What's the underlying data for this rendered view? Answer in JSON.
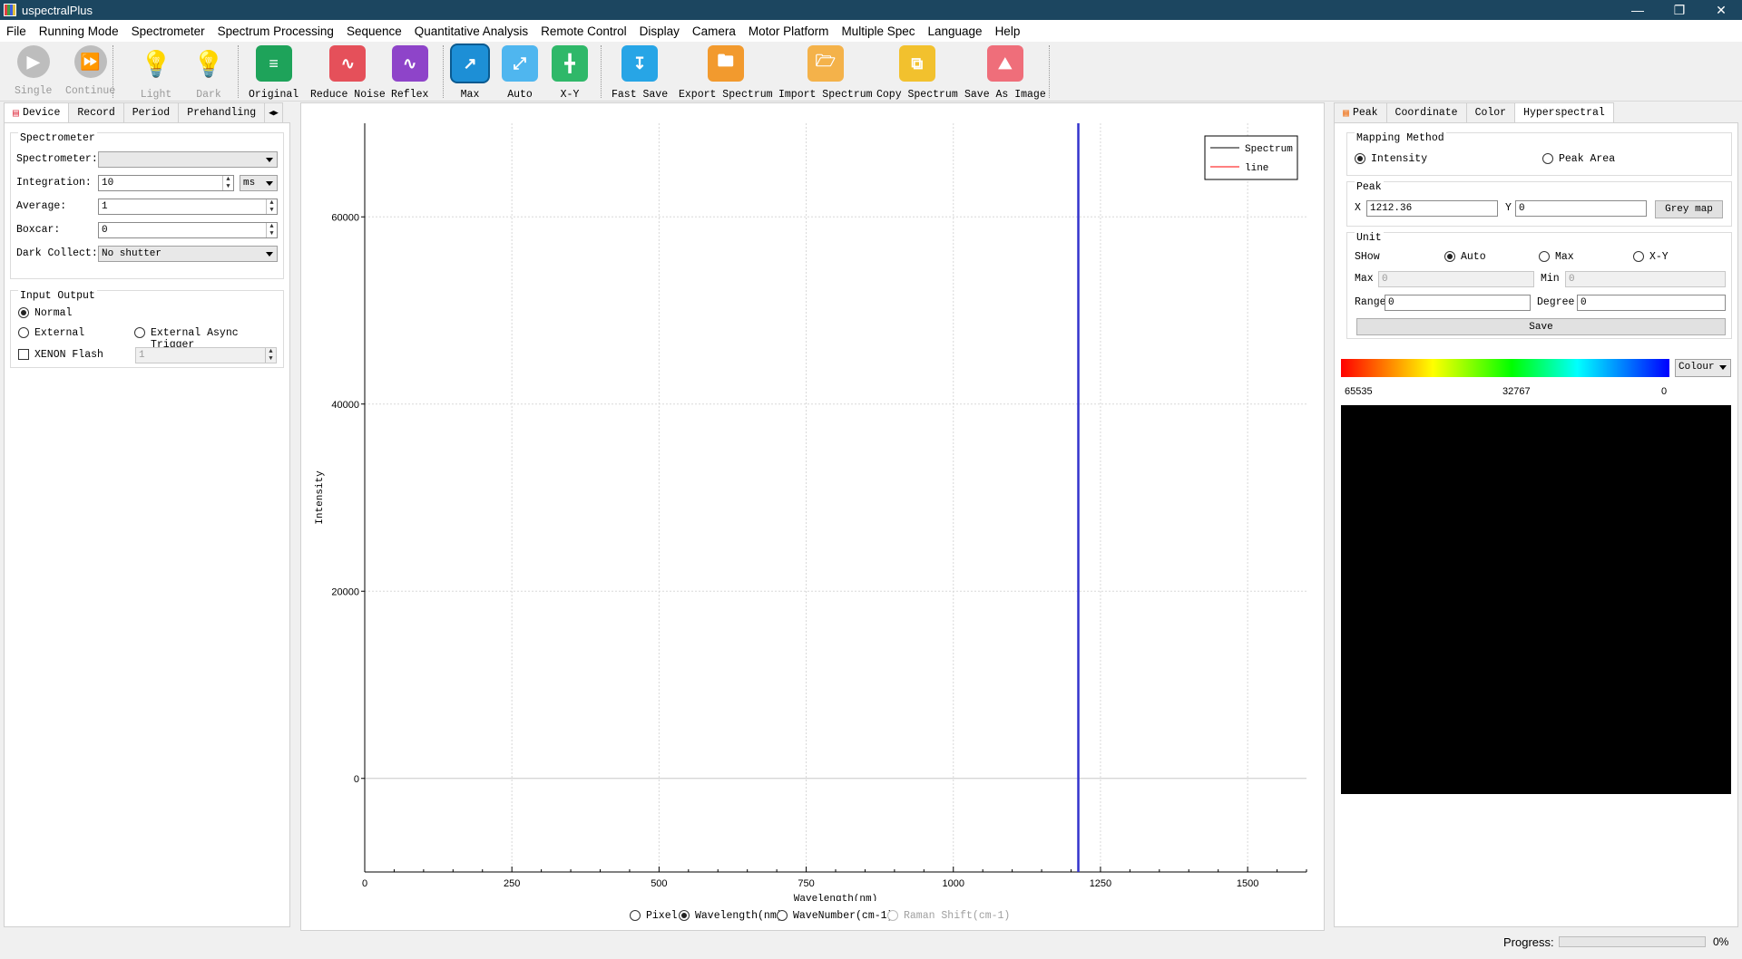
{
  "app": {
    "title": "uspectralPlus"
  },
  "menu": [
    "File",
    "Running Mode",
    "Spectrometer",
    "Spectrum Processing",
    "Sequence",
    "Quantitative Analysis",
    "Remote Control",
    "Display",
    "Camera",
    "Motor Platform",
    "Multiple Spec",
    "Language",
    "Help"
  ],
  "toolbar": {
    "single": "Single",
    "continue": "Continue",
    "light": "Light",
    "dark": "Dark",
    "original": "Original",
    "reduce_noise": "Reduce Noise",
    "reflex": "Reflex",
    "max": "Max",
    "auto": "Auto",
    "xy": "X-Y",
    "fast_save": "Fast Save",
    "export_spectrum": "Export Spectrum",
    "import_spectrum": "Import Spectrum",
    "copy_spectrum": "Copy Spectrum",
    "save_as_image": "Save As Image"
  },
  "left_tabs": [
    "Device",
    "Record",
    "Period",
    "Prehandling"
  ],
  "device": {
    "group_title": "Spectrometer",
    "spectrometer_label": "Spectrometer:",
    "spectrometer_value": "",
    "integration_label": "Integration:",
    "integration_value": "10",
    "integration_unit": "ms",
    "average_label": "Average:",
    "average_value": "1",
    "boxcar_label": "Boxcar:",
    "boxcar_value": "0",
    "dark_label": "Dark Collect:",
    "dark_value": "No shutter"
  },
  "io": {
    "group_title": "Input Output",
    "normal": "Normal",
    "external": "External",
    "external_async": "External Async Trigger",
    "xenon": "XENON Flash",
    "xenon_value": "1"
  },
  "chart_data": {
    "type": "line",
    "xlabel": "Wavelength(nm)",
    "ylabel": "Intensity",
    "xlim": [
      0,
      1600
    ],
    "ylim": [
      -10000,
      70000
    ],
    "xticks": [
      0,
      250,
      500,
      750,
      1000,
      1250,
      1500
    ],
    "yticks": [
      0,
      20000,
      40000,
      60000
    ],
    "grid": true,
    "legend_position": "top-right",
    "series": [
      {
        "name": "Spectrum",
        "color": "#000000",
        "values": []
      },
      {
        "name": "line",
        "color": "#ff0000",
        "values": []
      }
    ],
    "marker": {
      "x": 1212.36,
      "color": "#3333cc"
    }
  },
  "axis_modes": {
    "pixel": "Pixel",
    "wavelength": "Wavelength(nm)",
    "wavenumber": "WaveNumber(cm-1)",
    "raman": "Raman Shift(cm-1)"
  },
  "right_tabs": [
    "Peak",
    "Coordinate",
    "Color",
    "Hyperspectral"
  ],
  "hyper": {
    "mapping_title": "Mapping Method",
    "intensity": "Intensity",
    "peak_area": "Peak Area",
    "peak_title": "Peak",
    "x_label": "X",
    "x_value": "1212.36",
    "y_label": "Y",
    "y_value": "0",
    "grey_map": "Grey map",
    "unit_title": "Unit",
    "show_label": "SHow",
    "auto": "Auto",
    "max": "Max",
    "xy": "X-Y",
    "max_label": "Max",
    "max_value": "0",
    "min_label": "Min",
    "min_value": "0",
    "range_label": "Range",
    "range_value": "0",
    "degree_label": "Degree",
    "degree_value": "0",
    "save": "Save",
    "colour": "Colour",
    "scale_high": "65535",
    "scale_mid": "32767",
    "scale_low": "0"
  },
  "status": {
    "progress_label": "Progress:",
    "progress_text": "0%",
    "progress": 0
  }
}
